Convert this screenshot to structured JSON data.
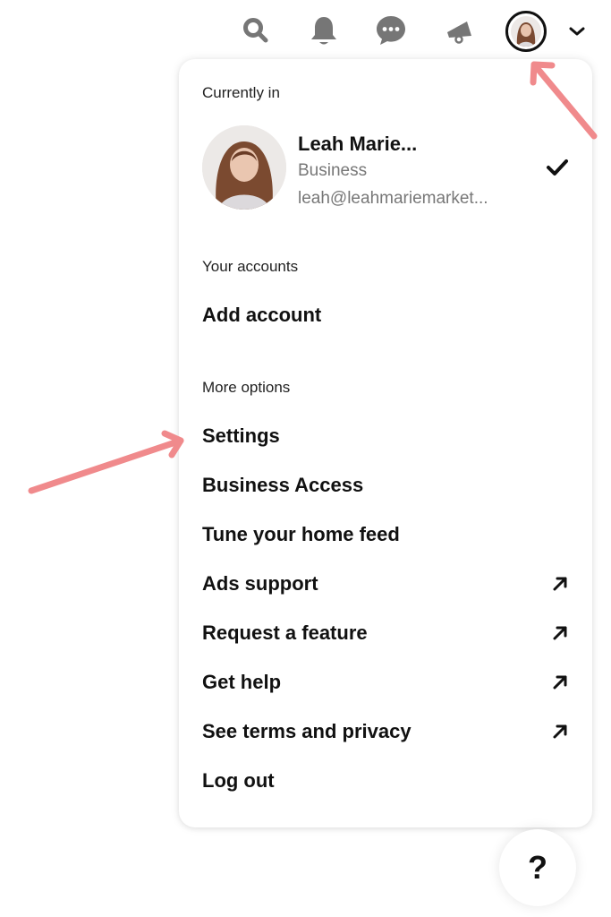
{
  "topbar": {
    "icons": [
      {
        "name": "search-icon",
        "label": "Search"
      },
      {
        "name": "bell-icon",
        "label": "Notifications"
      },
      {
        "name": "chat-icon",
        "label": "Messages"
      },
      {
        "name": "megaphone-icon",
        "label": "Updates"
      }
    ],
    "account_chevron": "chevron-down-icon"
  },
  "menu": {
    "currently_in_label": "Currently in",
    "current_account": {
      "name": "Leah Marie...",
      "type": "Business",
      "email": "leah@leahmariemarket...",
      "selected": true
    },
    "your_accounts_label": "Your accounts",
    "add_account_label": "Add account",
    "more_options_label": "More options",
    "items": [
      {
        "label": "Settings",
        "external": false
      },
      {
        "label": "Business Access",
        "external": false
      },
      {
        "label": "Tune your home feed",
        "external": false
      },
      {
        "label": "Ads support",
        "external": true
      },
      {
        "label": "Request a feature",
        "external": true
      },
      {
        "label": "Get help",
        "external": true
      },
      {
        "label": "See terms and privacy",
        "external": true
      },
      {
        "label": "Log out",
        "external": false
      }
    ]
  },
  "help_button": {
    "label": "?"
  },
  "colors": {
    "icon_gray": "#767676",
    "text_primary": "#111111",
    "text_secondary": "#777777",
    "annotation_arrow": "#f08a8c"
  }
}
